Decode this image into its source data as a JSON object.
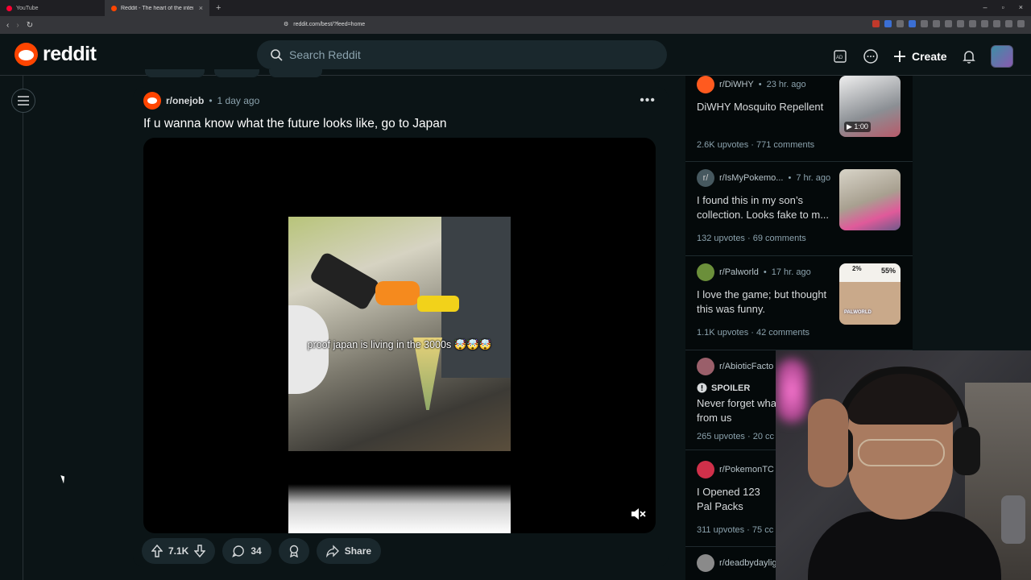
{
  "browser": {
    "tabs": [
      {
        "title": "YouTube",
        "color": "#ff0033"
      },
      {
        "title": "Reddit - The heart of the intern",
        "color": "#ff4500"
      }
    ],
    "url": "reddit.com/best/?feed=home"
  },
  "header": {
    "logo_text": "reddit",
    "search_placeholder": "Search Reddit",
    "create_label": "Create"
  },
  "post": {
    "subreddit": "r/onejob",
    "time": "1 day ago",
    "title": "If u wanna know what the future looks like, go to Japan",
    "video_caption": "proof japan is living in the 3000s 🤯🤯🤯",
    "upvotes": "7.1K",
    "comments": "34",
    "share_label": "Share"
  },
  "sidebar": {
    "cards": [
      {
        "subreddit": "r/DiWHY",
        "time": "23 hr. ago",
        "title": "DiWHY Mosquito Repellent",
        "upvotes": "2.6K upvotes",
        "comments": "771 comments",
        "duration": "1:00",
        "avatar_color": "#ff5a1f"
      },
      {
        "subreddit": "r/IsMyPokemo...",
        "time": "7 hr. ago",
        "title": "I found this in my son’s collection. Looks fake to m...",
        "upvotes": "132 upvotes",
        "comments": "69 comments",
        "avatar_color": "#46585f"
      },
      {
        "subreddit": "r/Palworld",
        "time": "17 hr. ago",
        "title": "I love the game; but thought this was funny.",
        "upvotes": "1.1K upvotes",
        "comments": "42 comments",
        "thumb_left": "2%",
        "thumb_right": "55%",
        "thumb_logo": "PALWORLD",
        "avatar_color": "#6b8f3a"
      },
      {
        "subreddit": "r/AbioticFacto",
        "spoiler": "SPOILER",
        "title": "Never forget wha from us",
        "upvotes": "265 upvotes",
        "comments": "20 cc",
        "avatar_color": "#9a5f6a"
      },
      {
        "subreddit": "r/PokemonTC",
        "title": "I Opened 123 Pal Packs",
        "upvotes": "311 upvotes",
        "comments": "75 cc",
        "avatar_color": "#d0304a"
      },
      {
        "subreddit": "r/deadbydaylig",
        "avatar_color": "#8a8a8a"
      }
    ]
  }
}
